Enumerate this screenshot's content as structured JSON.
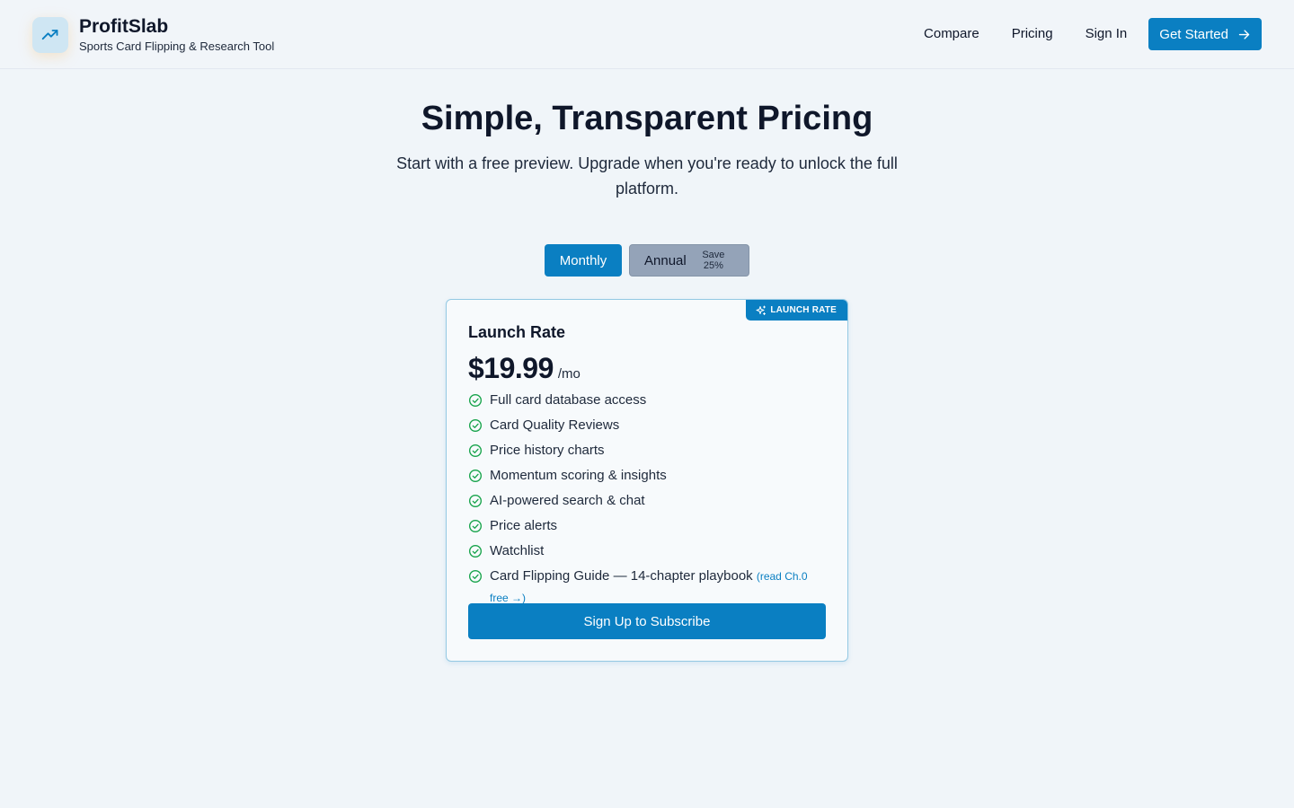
{
  "brand": {
    "name": "ProfitSlab",
    "tagline": "Sports Card Flipping & Research Tool",
    "logo_icon": "trending-up-icon"
  },
  "nav": {
    "links": [
      "Compare",
      "Pricing",
      "Sign In"
    ],
    "cta_label": "Get Started",
    "cta_icon": "arrow-right-icon"
  },
  "hero": {
    "title": "Simple, Transparent Pricing",
    "subtitle": "Start with a free preview. Upgrade when you're ready to unlock the full platform."
  },
  "billing_toggle": {
    "monthly_label": "Monthly",
    "annual_label": "Annual",
    "annual_note": "Save 25%",
    "selected": "Monthly"
  },
  "plan": {
    "badge": "LAUNCH RATE",
    "badge_icon": "sparkles-icon",
    "name": "Launch Rate",
    "price": "$19.99",
    "period": "/mo",
    "features": [
      "Full card database access",
      "Card Quality Reviews",
      "Price history charts",
      "Momentum scoring & insights",
      "AI-powered search & chat",
      "Price alerts",
      "Watchlist",
      "Card Flipping Guide — 14-chapter playbook"
    ],
    "guide_link": "(read Ch.0 free →)",
    "feature_icon": "check-circle-icon",
    "subscribe_label": "Sign Up to Subscribe"
  },
  "colors": {
    "accent": "#0a7fc2",
    "check": "#16a34a",
    "background": "#f0f5f9"
  }
}
